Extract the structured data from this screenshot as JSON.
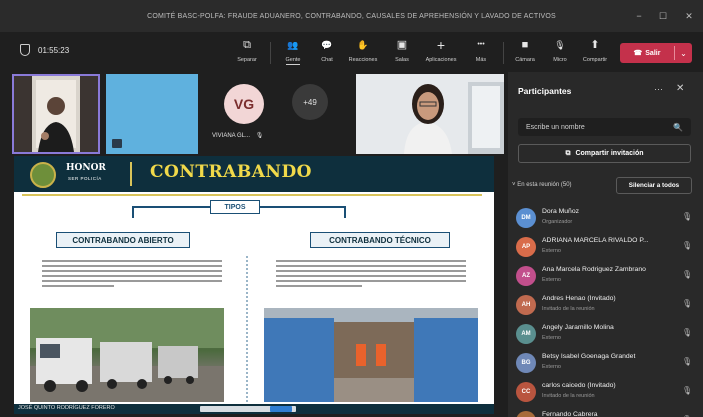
{
  "window": {
    "title": "COMITÉ BASC-POLFA: FRAUDE ADUANERO, CONTRABANDO, CAUSALES DE APREHENSIÓN Y LAVADO DE ACTIVOS",
    "minimize": "−",
    "maximize": "☐",
    "close": "✕"
  },
  "toolbar": {
    "timer": "01:55:23",
    "buttons": [
      {
        "label": "Separar",
        "icon": "pop-out-icon",
        "glyph": "⧉"
      },
      {
        "label": "Gente",
        "icon": "people-icon",
        "glyph": "👥"
      },
      {
        "label": "Chat",
        "icon": "chat-icon",
        "glyph": "💬"
      },
      {
        "label": "Reacciones",
        "icon": "reactions-icon",
        "glyph": "✋"
      },
      {
        "label": "Salas",
        "icon": "rooms-icon",
        "glyph": "▣"
      },
      {
        "label": "Aplicaciones",
        "icon": "apps-icon",
        "glyph": "+"
      },
      {
        "label": "Más",
        "icon": "more-icon",
        "glyph": "•••"
      },
      {
        "label": "Cámara",
        "icon": "camera-icon",
        "glyph": "■"
      },
      {
        "label": "Micro",
        "icon": "mic-off-icon",
        "glyph": "🎙"
      },
      {
        "label": "Compartir",
        "icon": "share-icon",
        "glyph": "⬆"
      }
    ],
    "leave_label": "Salir",
    "leave_dropdown": "⌄"
  },
  "strip": {
    "vg_initials": "VG",
    "vg_name": "VIVIANA GL...",
    "more_count": "+49"
  },
  "slide": {
    "brand_top": "HONOR",
    "brand_bottom": "SER POLICÍA",
    "title": "CONTRABANDO",
    "tipos": "TIPOS",
    "left_box": "CONTRABANDO ABIERTO",
    "right_box": "CONTRABANDO TÉCNICO",
    "presenter": "JOSÉ QUINTO RODRÍGUEZ FORERO"
  },
  "panel": {
    "title": "Participantes",
    "more": "···",
    "close": "✕",
    "search_placeholder": "Escribe un nombre",
    "share_invite": "Compartir invitación",
    "section": "En esta reunión (50)",
    "mute_all": "Silenciar a todos",
    "participants": [
      {
        "initials": "DM",
        "name": "Dora Muñoz",
        "role": "Organizador",
        "color": "#5b8fd1"
      },
      {
        "initials": "AP",
        "name": "ADRIANA MARCELA RIVALDO P...",
        "role": "Externo",
        "color": "#d96c4a"
      },
      {
        "initials": "AZ",
        "name": "Ana Marcela Rodriguez Zambrano",
        "role": "Externo",
        "color": "#c24f8c"
      },
      {
        "initials": "AH",
        "name": "Andres Henao (Invitado)",
        "role": "Invitado de la reunión",
        "color": "#c06a4f"
      },
      {
        "initials": "AM",
        "name": "Angely Jaramillo Molina",
        "role": "Externo",
        "color": "#5a8f8f"
      },
      {
        "initials": "BG",
        "name": "Betsy Isabel Goenaga Grandet",
        "role": "Externo",
        "color": "#6f88b7"
      },
      {
        "initials": "CC",
        "name": "carlos caicedo (Invitado)",
        "role": "Invitado de la reunión",
        "color": "#b9553f"
      },
      {
        "initials": "FC",
        "name": "Fernando Cabrera",
        "role": "",
        "color": "#a86b3a"
      }
    ]
  }
}
